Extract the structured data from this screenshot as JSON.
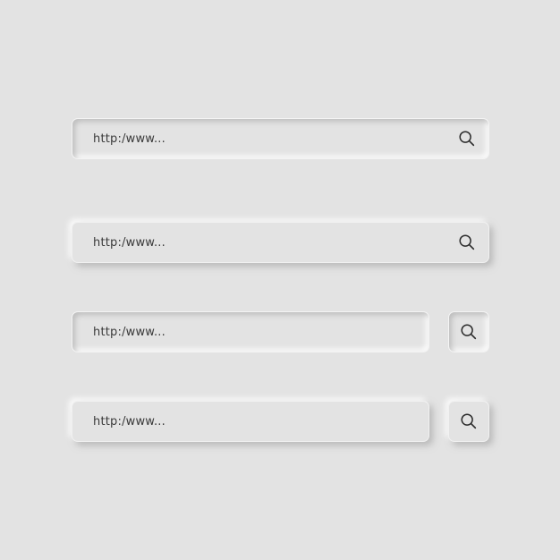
{
  "colors": {
    "background": "#e3e3e3",
    "text": "#3a3a3a",
    "icon": "#2b2b2b"
  },
  "bars": [
    {
      "style": "inset",
      "placeholder": "http:/www...",
      "icon": "search-icon",
      "button_layout": "embedded"
    },
    {
      "style": "raised",
      "placeholder": "http:/www...",
      "icon": "search-icon",
      "button_layout": "embedded"
    },
    {
      "style": "inset",
      "placeholder": "http:/www...",
      "icon": "search-icon",
      "button_layout": "separate"
    },
    {
      "style": "raised",
      "placeholder": "http:/www...",
      "icon": "search-icon",
      "button_layout": "separate"
    }
  ]
}
